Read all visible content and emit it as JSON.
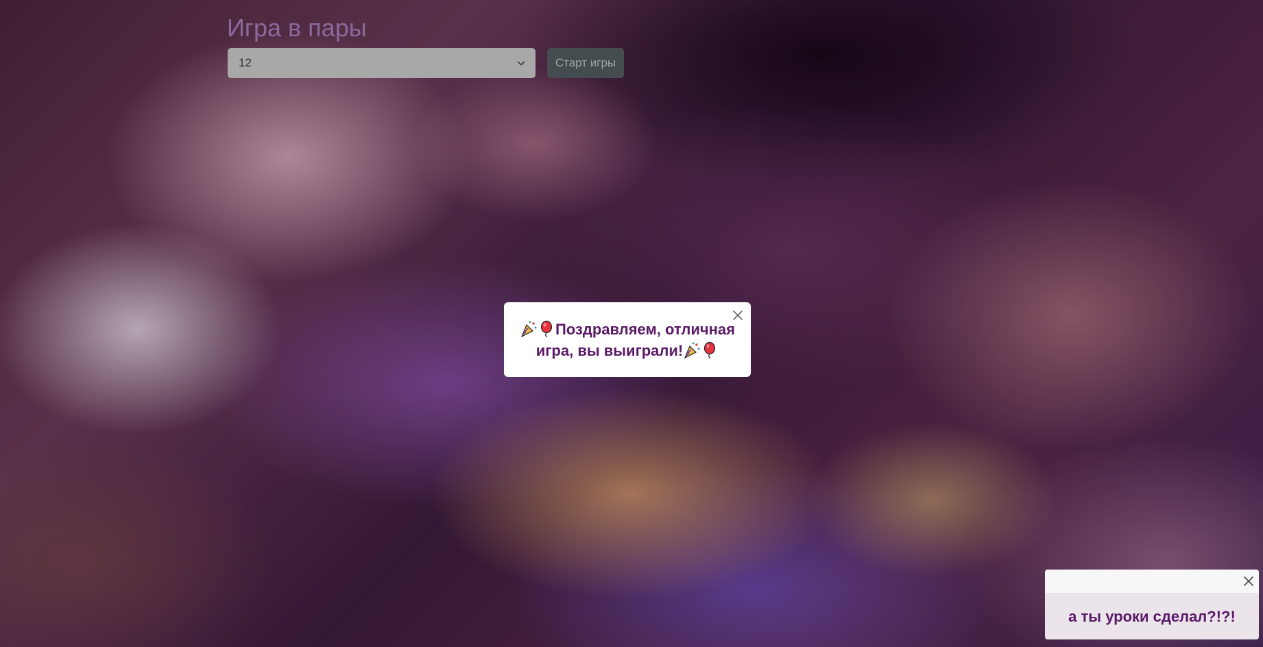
{
  "header": {
    "title": "Игра в пары"
  },
  "controls": {
    "pairs_select": {
      "selected": "12"
    },
    "start_label": "Старт игры"
  },
  "win_modal": {
    "message": "Поздравляем, отличная игра, вы выиграли!",
    "icons": [
      "party-popper-icon",
      "balloon-icon",
      "party-popper-icon",
      "balloon-icon",
      "close-icon"
    ]
  },
  "toast": {
    "message": "а ты уроки сделал?!?!",
    "icons": [
      "close-icon"
    ]
  },
  "colors": {
    "accent_text": "#5a1a66",
    "title_text": "#8a6a9a",
    "button_bg": "#454c50"
  }
}
